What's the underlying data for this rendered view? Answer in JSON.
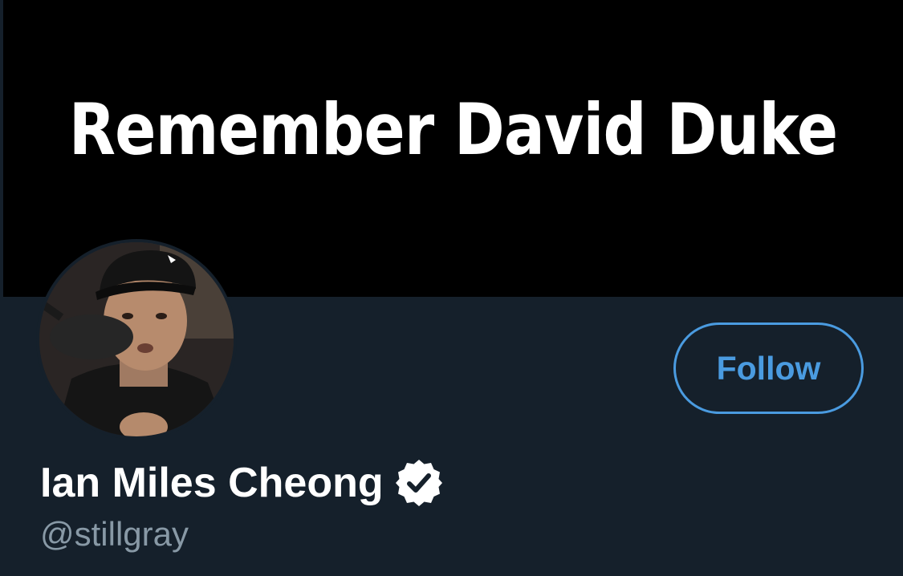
{
  "banner": {
    "text": "Remember David Duke"
  },
  "profile": {
    "display_name": "Ian Miles Cheong",
    "handle": "@stillgray",
    "verified": true,
    "follow_label": "Follow"
  },
  "icons": {
    "verified": "verified-badge-icon"
  },
  "colors": {
    "background": "#15202b",
    "banner_background": "#000000",
    "accent": "#4a9be0",
    "handle_text": "#8899a6"
  }
}
